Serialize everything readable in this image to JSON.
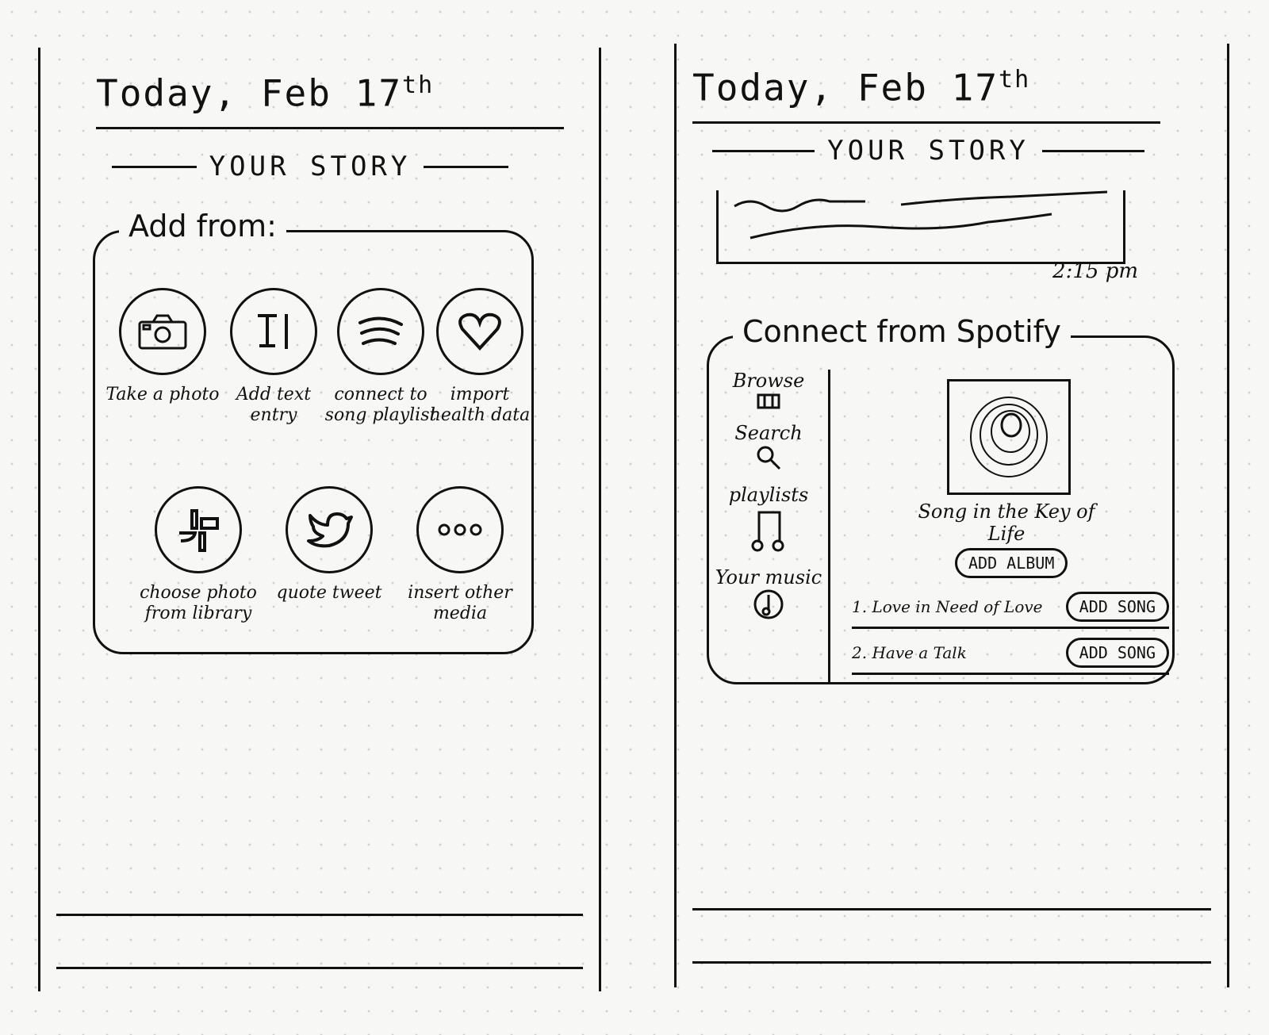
{
  "left_screen": {
    "date_title": "Today, Feb 17",
    "date_sup": "th",
    "story_title": "YOUR STORY",
    "add_from_legend": "Add from:",
    "options": [
      {
        "icon": "camera-icon",
        "label": "Take a photo"
      },
      {
        "icon": "text-icon",
        "label": "Add text entry"
      },
      {
        "icon": "spotify-icon",
        "label": "connect to song playlist"
      },
      {
        "icon": "heart-icon",
        "label": "import health data"
      },
      {
        "icon": "photos-icon",
        "label": "choose photo from library"
      },
      {
        "icon": "twitter-bird-icon",
        "label": "quote tweet"
      },
      {
        "icon": "more-icon",
        "label": "insert other media"
      }
    ]
  },
  "right_screen": {
    "date_title": "Today, Feb 17",
    "date_sup": "th",
    "story_title": "YOUR STORY",
    "timestamp": "2:15 pm",
    "spotify_legend": "Connect from Spotify",
    "nav": [
      {
        "icon": "browse-icon",
        "label": "Browse"
      },
      {
        "icon": "search-icon",
        "label": "Search"
      },
      {
        "icon": "music-note-icon",
        "label": "playlists"
      },
      {
        "icon": "your-music-icon",
        "label": "Your music"
      }
    ],
    "album_title": "Song in the Key of Life",
    "add_album_label": "ADD ALBUM",
    "songs": [
      {
        "number": "1.",
        "title": "Love in Need of Love",
        "button": "ADD SONG"
      },
      {
        "number": "2.",
        "title": "Have a Talk",
        "button": "ADD SONG"
      }
    ]
  }
}
